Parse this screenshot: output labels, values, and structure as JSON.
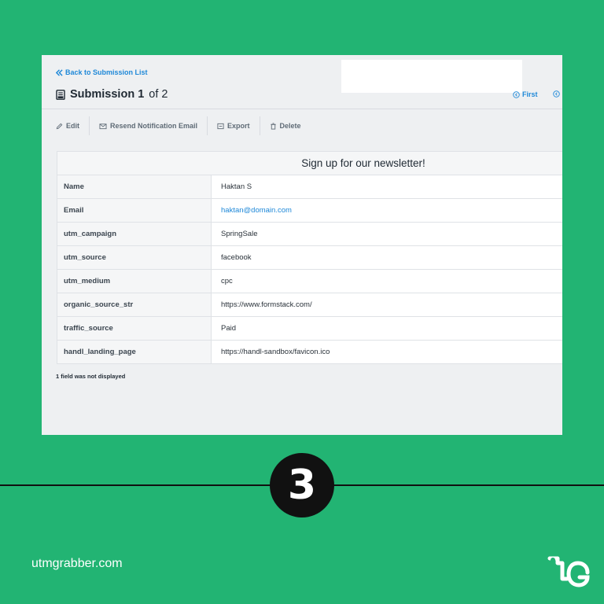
{
  "panel": {
    "back_link": "Back to Submission List",
    "title_bold": "Submission 1",
    "title_rest": "of 2",
    "first_link": "First",
    "toolbar": {
      "edit": "Edit",
      "resend": "Resend Notification Email",
      "export": "Export",
      "delete": "Delete"
    },
    "form_title": "Sign up for our newsletter!",
    "fields": [
      {
        "key": "Name",
        "value": "Haktan S"
      },
      {
        "key": "Email",
        "value": "haktan@domain.com"
      },
      {
        "key": "utm_campaign",
        "value": "SpringSale"
      },
      {
        "key": "utm_source",
        "value": "facebook"
      },
      {
        "key": "utm_medium",
        "value": "cpc"
      },
      {
        "key": "organic_source_str",
        "value": "https://www.formstack.com/"
      },
      {
        "key": "traffic_source",
        "value": "Paid"
      },
      {
        "key": "handl_landing_page",
        "value": "https://handl-sandbox/favicon.ico"
      }
    ],
    "note": "1 field was not displayed"
  },
  "step_badge": "3",
  "brand_text": "utmgrabber.com",
  "colors": {
    "background": "#22b473",
    "link": "#1e88d8",
    "panel": "#eef0f2"
  },
  "icons": {
    "back": "double-chevron-left-icon",
    "document": "document-icon",
    "first": "first-circle-icon",
    "edit": "pencil-icon",
    "resend": "mail-icon",
    "export": "export-icon",
    "delete": "trash-icon",
    "logo": "utmgrabber-logo"
  }
}
